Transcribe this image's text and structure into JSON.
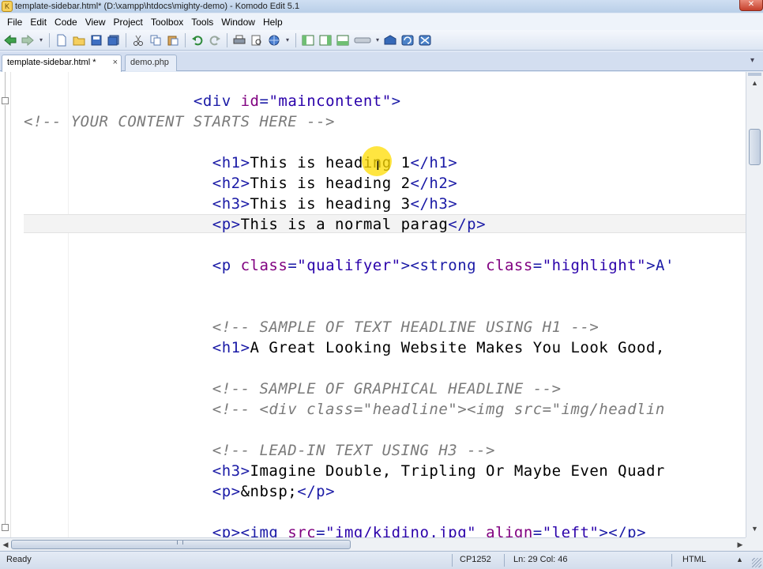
{
  "window": {
    "title": "template-sidebar.html* (D:\\xampp\\htdocs\\mighty-demo) - Komodo Edit 5.1",
    "close_glyph": "✕"
  },
  "menu": {
    "items": [
      "File",
      "Edit",
      "Code",
      "View",
      "Project",
      "Toolbox",
      "Tools",
      "Window",
      "Help"
    ]
  },
  "toolbar": {
    "buttons": [
      "back",
      "forward",
      "new-file",
      "open-folder",
      "save",
      "save-all",
      "cut",
      "copy",
      "paste",
      "undo",
      "redo",
      "print",
      "preview",
      "browser",
      "toolbox-a",
      "toolbox-b",
      "toolbox-c",
      "macro",
      "commit",
      "refresh",
      "move"
    ]
  },
  "tabs": [
    {
      "label": "template-sidebar.html *",
      "close": "×",
      "active": true
    },
    {
      "label": "demo.php",
      "active": false
    }
  ],
  "editor": {
    "lines": [
      [
        [
          "tag",
          "                  <div "
        ],
        [
          "attr",
          "id"
        ],
        [
          "tag",
          "="
        ],
        [
          "str",
          "\"maincontent\""
        ],
        [
          "tag",
          ">"
        ]
      ],
      [
        [
          "cmt",
          "<!-- YOUR CONTENT STARTS HERE -->"
        ]
      ],
      [
        [
          "txt",
          ""
        ]
      ],
      [
        [
          "tag",
          "                    <h1>"
        ],
        [
          "txt",
          "This is heading 1"
        ],
        [
          "tag",
          "</h1>"
        ]
      ],
      [
        [
          "tag",
          "                    <h2>"
        ],
        [
          "txt",
          "This is heading 2"
        ],
        [
          "tag",
          "</h2>"
        ]
      ],
      [
        [
          "tag",
          "                    <h3>"
        ],
        [
          "txt",
          "This is heading 3"
        ],
        [
          "tag",
          "</h3>"
        ]
      ],
      [
        [
          "tag",
          "                    <p>"
        ],
        [
          "txt",
          "This is a normal parag"
        ],
        [
          "tag",
          "</p>"
        ]
      ],
      [
        [
          "txt",
          ""
        ]
      ],
      [
        [
          "tag",
          "                    <p "
        ],
        [
          "attr",
          "class"
        ],
        [
          "tag",
          "="
        ],
        [
          "str",
          "\"qualifyer\""
        ],
        [
          "tag",
          "><strong "
        ],
        [
          "attr",
          "class"
        ],
        [
          "tag",
          "="
        ],
        [
          "str",
          "\"highlight\""
        ],
        [
          "tag",
          ">A'"
        ]
      ],
      [
        [
          "txt",
          ""
        ]
      ],
      [
        [
          "txt",
          ""
        ]
      ],
      [
        [
          "cmt",
          "                    <!-- SAMPLE OF TEXT HEADLINE USING H1 -->"
        ]
      ],
      [
        [
          "tag",
          "                    <h1>"
        ],
        [
          "txt",
          "A Great Looking Website Makes You Look Good,"
        ]
      ],
      [
        [
          "txt",
          ""
        ]
      ],
      [
        [
          "cmt",
          "                    <!-- SAMPLE OF GRAPHICAL HEADLINE -->"
        ]
      ],
      [
        [
          "cmt",
          "                    <!-- <div class=\"headline\"><img src=\"img/headlin"
        ]
      ],
      [
        [
          "txt",
          ""
        ]
      ],
      [
        [
          "cmt",
          "                    <!-- LEAD-IN TEXT USING H3 -->"
        ]
      ],
      [
        [
          "tag",
          "                    <h3>"
        ],
        [
          "txt",
          "Imagine Double, Tripling Or Maybe Even Quadr"
        ]
      ],
      [
        [
          "tag",
          "                    <p>"
        ],
        [
          "txt",
          "&nbsp;"
        ],
        [
          "tag",
          "</p>"
        ]
      ],
      [
        [
          "txt",
          ""
        ]
      ],
      [
        [
          "tag",
          "                    <p><img "
        ],
        [
          "attr",
          "src"
        ],
        [
          "tag",
          "="
        ],
        [
          "str",
          "\"img/kidino.jpg\""
        ],
        [
          "txt",
          " "
        ],
        [
          "attr",
          "align"
        ],
        [
          "tag",
          "="
        ],
        [
          "str",
          "\"left\""
        ],
        [
          "tag",
          "></p>"
        ]
      ]
    ]
  },
  "scrollbars": {
    "up": "▲",
    "down": "▼",
    "left": "◀",
    "right": "▶"
  },
  "status": {
    "ready": "Ready",
    "encoding": "CP1252",
    "position": "Ln: 29 Col: 46",
    "language": "HTML",
    "dropdown": "▲"
  }
}
